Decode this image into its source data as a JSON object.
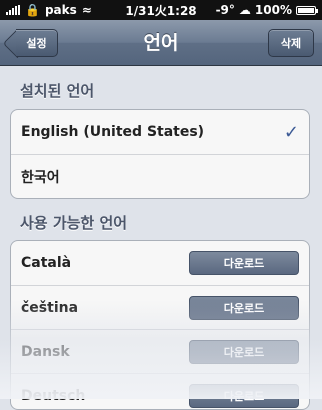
{
  "status_bar": {
    "carrier": "paks",
    "time": "1/31火1:28",
    "temperature": "-9°",
    "battery": "100%",
    "icons": [
      "signal-bars-icon",
      "lock-icon",
      "wifi-icon",
      "cloud-icon",
      "battery-icon"
    ]
  },
  "nav": {
    "back_label": "설정",
    "title": "언어",
    "action_label": "삭제"
  },
  "installed": {
    "header": "설치된 언어",
    "items": [
      {
        "name": "English (United States)",
        "selected": true,
        "check": "✓"
      },
      {
        "name": "한국어",
        "selected": false
      }
    ]
  },
  "available": {
    "header": "사용 가능한 언어",
    "download_label": "다운로드",
    "items": [
      {
        "name": "Català",
        "download": "다운로드"
      },
      {
        "name": "čeština",
        "download": "다운로드"
      },
      {
        "name": "Dansk",
        "download": "다운로드"
      },
      {
        "name": "Deutsch",
        "download": "다운로드"
      }
    ]
  },
  "colors": {
    "nav": "#6b7b92",
    "checkmark": "#3c5a95",
    "background": "#dfe3ea"
  }
}
